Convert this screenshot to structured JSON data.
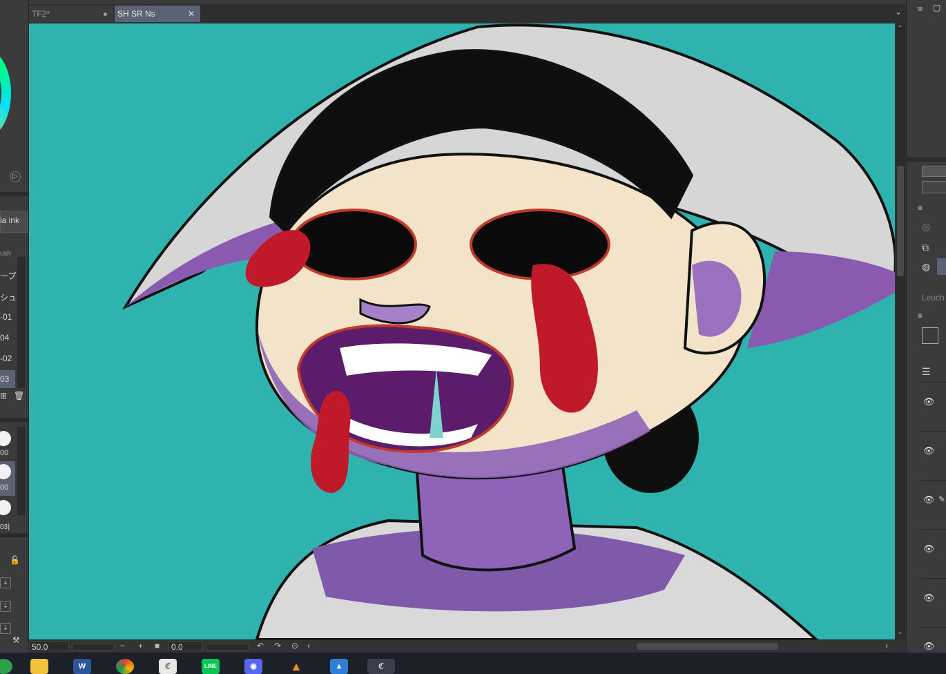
{
  "tabs": [
    {
      "label": "TF2*",
      "mark": "●"
    },
    {
      "label": "SH SR Ns",
      "mark": "✕"
    }
  ],
  "left_panel": {
    "brush_name_partial": "ia ink",
    "header_partial": "ush",
    "sub_tool_items": [
      "ープ",
      "シュ",
      "-01",
      "04",
      "-02",
      "03"
    ],
    "brush_size_values": [
      "00",
      "00"
    ],
    "brush_size_label": "03]"
  },
  "status_bar": {
    "zoom_value": "50.0",
    "rotation_value": "0.0"
  },
  "right_panel": {
    "property_label_partial": "Leuch"
  },
  "taskbar": {
    "apps": [
      "File Explorer",
      "Word",
      "Chrome",
      "Clip Studio Paint",
      "LINE",
      "Discord",
      "VLC",
      "Photos",
      "Clip Studio"
    ]
  },
  "colors": {
    "canvas_background": "#2fb3ae",
    "active_tab": "#5a6274",
    "panel": "#3b3b3b"
  }
}
